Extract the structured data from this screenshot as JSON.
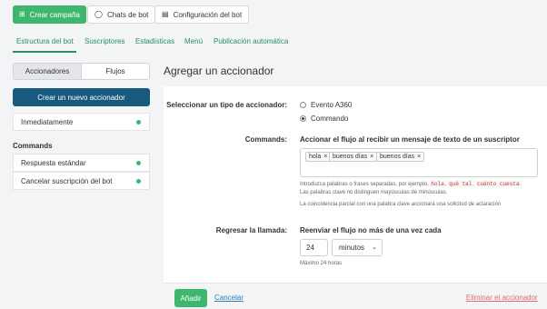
{
  "toolbar": {
    "create_campaign": "Crear campaña",
    "bot_chats": "Chats de bot",
    "bot_settings": "Configuración del bot"
  },
  "tabs": [
    {
      "label": "Estructura del bot",
      "active": true
    },
    {
      "label": "Suscriptores"
    },
    {
      "label": "Estadísticas"
    },
    {
      "label": "Menú"
    },
    {
      "label": "Publicación automática"
    }
  ],
  "sidebar": {
    "segment": {
      "triggers": "Accionadores",
      "flows": "Flujos",
      "selected": "Accionadores"
    },
    "create_button": "Crear un nuevo accionador",
    "immediately": "Inmediatamente",
    "commands_heading": "Commands",
    "items": [
      {
        "label": "Respuesta estándar"
      },
      {
        "label": "Cancelar suscripción del bot"
      }
    ],
    "status_color": "#3fb66e"
  },
  "panel": {
    "title": "Agregar un accionador",
    "trigger_type_label": "Seleccionar un tipo de accionador:",
    "options": [
      {
        "label": "Evento A360",
        "selected": false
      },
      {
        "label": "Commando",
        "selected": true
      }
    ],
    "commands_label": "Commands:",
    "commands_title": "Accionar el flujo al recibir un mensaje de texto de un suscriptor",
    "tags": [
      "hola",
      "buenos días",
      "buenos días"
    ],
    "hint_line1_prefix": "Introduzca palabras o frases separadas, por ejemplo,",
    "hint_examples": [
      "hola",
      "qué tal",
      "cuánto cuesta"
    ],
    "hint_line2": "Las palabras clave no distinguen mayúsculas de minúsculas.",
    "hint_line3": "La coincidencia parcial con una palabra clave accionará una solicitud de aclaración",
    "callback_label": "Regresar la llamada:",
    "callback_title": "Reenviar el flujo no más de una vez cada",
    "callback_value": "24",
    "callback_unit": "minutos",
    "callback_hint": "Máximo 24 horas"
  },
  "footer": {
    "add": "Añadir",
    "cancel": "Cancelar",
    "delete": "Eliminar el accionador"
  },
  "colors": {
    "accent_green": "#3fb66e",
    "primary_blue": "#185a7d",
    "tab_green": "#2a8d63",
    "link_blue": "#2f7fb5",
    "danger": "#e26b6b"
  }
}
